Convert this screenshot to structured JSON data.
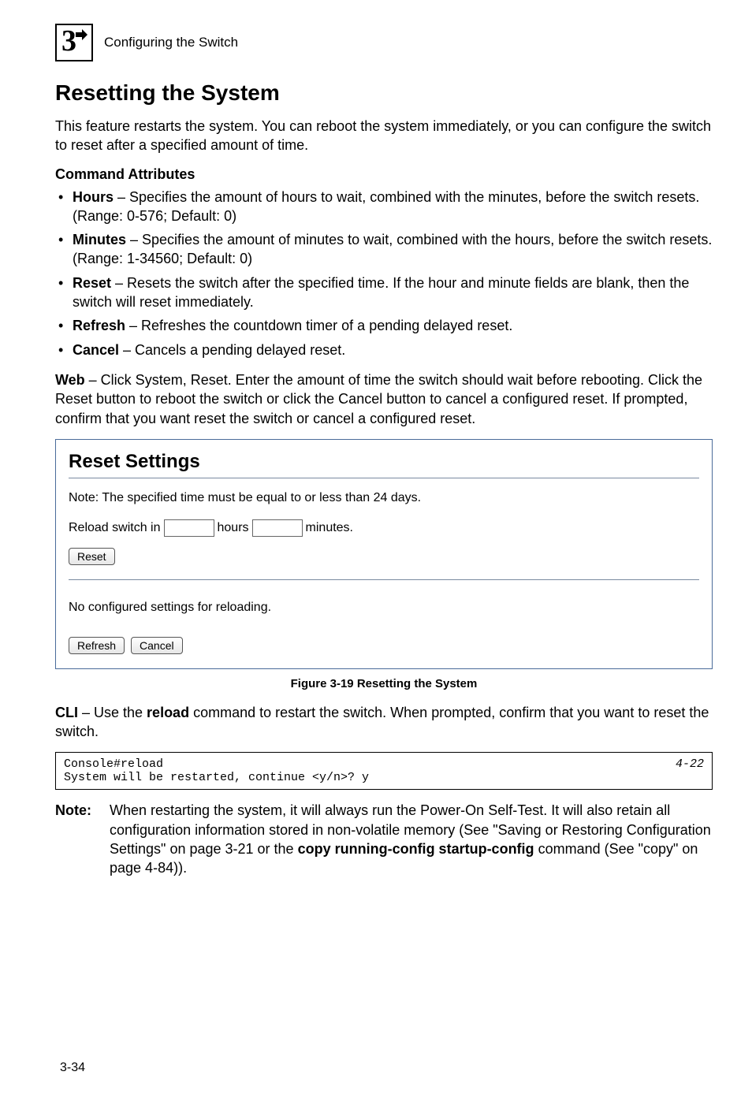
{
  "header": {
    "chapter_number": "3",
    "running_head": "Configuring the Switch"
  },
  "section": {
    "title": "Resetting the System",
    "intro": "This feature restarts the system. You can reboot the system immediately, or you can configure the switch to reset after a specified amount of time.",
    "attributes_heading": "Command Attributes",
    "bullets": [
      {
        "term": "Hours",
        "desc": " – Specifies the amount of hours to wait, combined with the minutes, before the switch resets. (Range: 0-576; Default: 0)"
      },
      {
        "term": "Minutes",
        "desc": " – Specifies the amount of minutes to wait, combined with the hours, before the switch resets. (Range: 1-34560; Default: 0)"
      },
      {
        "term": "Reset",
        "desc": " – Resets the switch after the specified time. If the hour and minute fields are blank, then the switch will reset immediately."
      },
      {
        "term": "Refresh",
        "desc": " – Refreshes the countdown timer of a pending delayed reset."
      },
      {
        "term": "Cancel",
        "desc": " – Cancels a pending delayed reset."
      }
    ],
    "web_lead": "Web",
    "web_text": " – Click System, Reset. Enter the amount of time the switch should wait before rebooting. Click the Reset button to reboot the switch or click the Cancel button to cancel a configured reset. If prompted, confirm that you want reset the switch or cancel a configured reset."
  },
  "panel": {
    "title": "Reset Settings",
    "note": "Note: The specified time must be equal to or less than 24 days.",
    "prefix": "Reload switch in",
    "hours_label": "hours",
    "minutes_label": "minutes.",
    "reset_btn": "Reset",
    "status": "No configured settings for reloading.",
    "refresh_btn": "Refresh",
    "cancel_btn": "Cancel"
  },
  "figure_caption": "Figure 3-19   Resetting the System",
  "cli": {
    "lead": "CLI",
    "text": " – Use the ",
    "cmd": "reload",
    "text2": " command to restart the switch. When prompted, confirm that you want to reset the switch.",
    "line1": "Console#reload",
    "line2": "System will be restarted, continue <y/n>? y",
    "ref": "4-22"
  },
  "note": {
    "label": "Note:",
    "part1": "When restarting the system, it will always run the Power-On Self-Test. It will also retain all configuration information stored in non-volatile memory (See \"Saving or Restoring Configuration Settings\" on page 3-21 or the ",
    "bold1": "copy running-config startup-config",
    "part2": " command (See \"copy\" on page 4-84))."
  },
  "page_number": "3-34"
}
